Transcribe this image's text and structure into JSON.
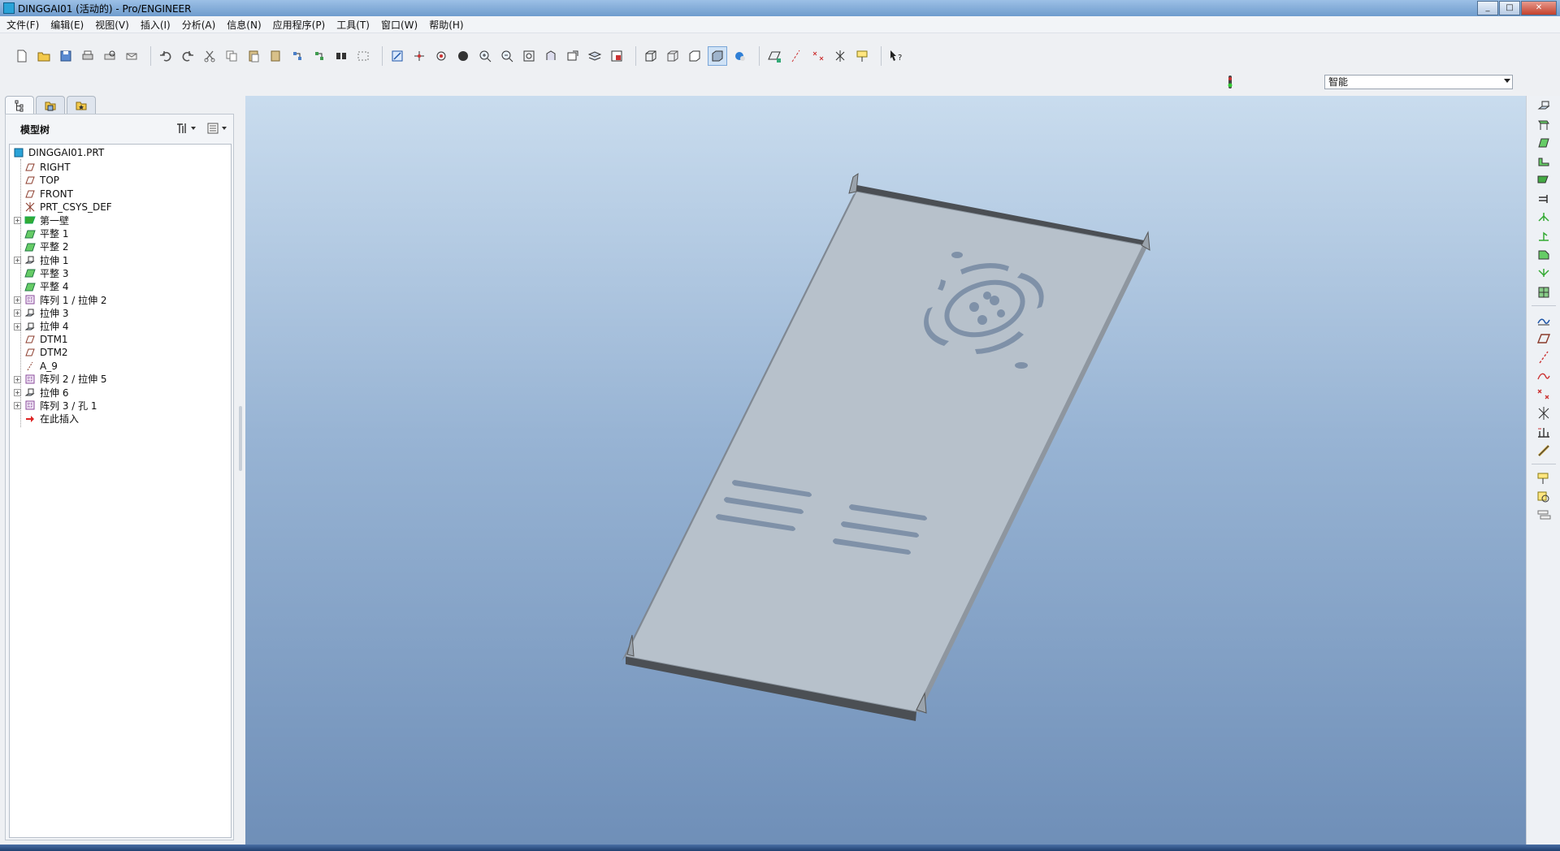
{
  "window": {
    "title": "DINGGAI01 (活动的) - Pro/ENGINEER",
    "minimize": "_",
    "maximize": "□",
    "close": "✕"
  },
  "menu": [
    "文件(F)",
    "编辑(E)",
    "视图(V)",
    "插入(I)",
    "分析(A)",
    "信息(N)",
    "应用程序(P)",
    "工具(T)",
    "窗口(W)",
    "帮助(H)"
  ],
  "toolbar_icons": [
    "new-file-icon",
    "open-file-icon",
    "save-icon",
    "print-icon",
    "print-preview-icon",
    "email-icon",
    "undo-icon",
    "redo-icon",
    "cut-icon",
    "copy-icon",
    "paste-icon",
    "paste-special-icon",
    "regenerate-icon",
    "regenerate-manager-icon",
    "find-icon",
    "select-box-icon",
    "repaint-icon",
    "spin-center-icon",
    "orient-mode-icon",
    "display-style-icon",
    "zoom-in-icon",
    "zoom-out-icon",
    "refit-icon",
    "reorient-icon",
    "saved-views-icon",
    "layers-icon",
    "view-manager-icon",
    "wireframe-icon",
    "hidden-line-icon",
    "no-hidden-icon",
    "shading-icon",
    "enhanced-realism-icon",
    "datum-planes-icon",
    "datum-axes-icon",
    "datum-points-icon",
    "coordinate-systems-icon",
    "annotations-icon",
    "whats-this-icon"
  ],
  "filter": {
    "selected": "智能"
  },
  "nav_tabs": [
    "model-tree-tab",
    "folder-browser-tab",
    "favorites-tab"
  ],
  "model_tree": {
    "label": "模型树",
    "root": "DINGGAI01.PRT",
    "items": [
      {
        "label": "RIGHT",
        "icon": "datum-plane-icon",
        "expandable": false
      },
      {
        "label": "TOP",
        "icon": "datum-plane-icon",
        "expandable": false
      },
      {
        "label": "FRONT",
        "icon": "datum-plane-icon",
        "expandable": false
      },
      {
        "label": "PRT_CSYS_DEF",
        "icon": "coordinate-system-icon",
        "expandable": false
      },
      {
        "label": "第一壁",
        "icon": "first-wall-icon",
        "expandable": true
      },
      {
        "label": "平整 1",
        "icon": "flat-wall-icon",
        "expandable": false
      },
      {
        "label": "平整 2",
        "icon": "flat-wall-icon",
        "expandable": false
      },
      {
        "label": "拉伸 1",
        "icon": "extrude-icon",
        "expandable": true
      },
      {
        "label": "平整 3",
        "icon": "flat-wall-icon",
        "expandable": false
      },
      {
        "label": "平整 4",
        "icon": "flat-wall-icon",
        "expandable": false
      },
      {
        "label": "阵列 1 / 拉伸 2",
        "icon": "pattern-icon",
        "expandable": true
      },
      {
        "label": "拉伸 3",
        "icon": "extrude-icon",
        "expandable": true
      },
      {
        "label": "拉伸 4",
        "icon": "extrude-icon",
        "expandable": true
      },
      {
        "label": "DTM1",
        "icon": "datum-plane-icon",
        "expandable": false
      },
      {
        "label": "DTM2",
        "icon": "datum-plane-icon",
        "expandable": false
      },
      {
        "label": "A_9",
        "icon": "datum-axis-icon",
        "expandable": false
      },
      {
        "label": "阵列 2 / 拉伸 5",
        "icon": "pattern-icon",
        "expandable": true
      },
      {
        "label": "拉伸 6",
        "icon": "extrude-icon",
        "expandable": true
      },
      {
        "label": "阵列 3 / 孔 1",
        "icon": "pattern-icon",
        "expandable": true
      },
      {
        "label": "在此插入",
        "icon": "insert-here-arrow-icon",
        "expandable": false
      }
    ]
  },
  "right_toolbar_icons": [
    "extrude-tool-icon",
    "revolve-tool-icon",
    "flat-tool-icon",
    "flange-tool-icon",
    "unattached-wall-icon",
    "extend-icon",
    "rip-icon",
    "bend-icon",
    "unbend-icon",
    "bend-back-icon",
    "form-icon",
    "sketch-tool-icon",
    "datum-plane-tool-icon",
    "datum-axis-tool-icon",
    "datum-curve-tool-icon",
    "datum-point-tool-icon",
    "csys-tool-icon",
    "analysis-tool-icon",
    "chain-icon",
    "annotation-feature-icon",
    "mirror-icon",
    "pattern-tool-icon"
  ],
  "colors": {
    "viewport_top": "#c9dcee",
    "viewport_bottom": "#6f8fb8",
    "part": "#b9c2ca"
  }
}
